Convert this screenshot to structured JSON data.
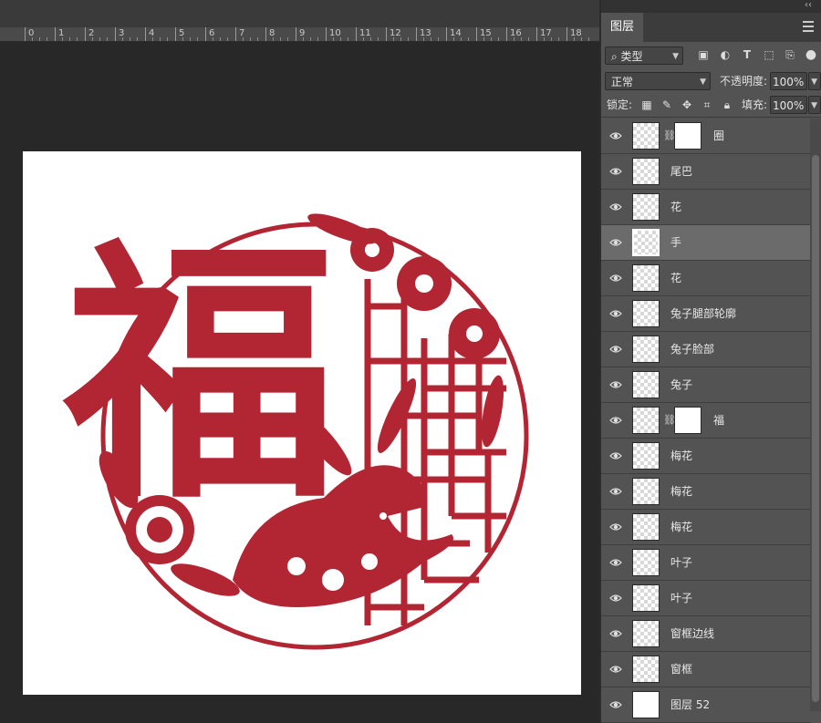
{
  "ruler": {
    "marks": [
      "0",
      "1",
      "2",
      "3",
      "4",
      "5",
      "6",
      "7",
      "8",
      "9",
      "10",
      "11",
      "12",
      "13",
      "14",
      "15",
      "16",
      "17",
      "18"
    ]
  },
  "artwork": {
    "character": "福",
    "color": "#b22634"
  },
  "panel": {
    "tab_label": "图层",
    "filter": {
      "label": "类型"
    },
    "blend_mode": "正常",
    "opacity_label": "不透明度:",
    "opacity_value": "100%",
    "lock_label": "锁定:",
    "fill_label": "填充:",
    "fill_value": "100%"
  },
  "layers": [
    {
      "name": "圈",
      "has_mask": true,
      "selected": false
    },
    {
      "name": "尾巴",
      "has_mask": false,
      "selected": false
    },
    {
      "name": "花",
      "has_mask": false,
      "selected": false
    },
    {
      "name": "手",
      "has_mask": false,
      "selected": true
    },
    {
      "name": "花",
      "has_mask": false,
      "selected": false
    },
    {
      "name": "兔子腿部轮廓",
      "has_mask": false,
      "selected": false
    },
    {
      "name": "兔子脸部",
      "has_mask": false,
      "selected": false
    },
    {
      "name": "兔子",
      "has_mask": false,
      "selected": false
    },
    {
      "name": "福",
      "has_mask": true,
      "selected": false
    },
    {
      "name": "梅花",
      "has_mask": false,
      "selected": false
    },
    {
      "name": "梅花",
      "has_mask": false,
      "selected": false
    },
    {
      "name": "梅花",
      "has_mask": false,
      "selected": false
    },
    {
      "name": "叶子",
      "has_mask": false,
      "selected": false
    },
    {
      "name": "叶子",
      "has_mask": false,
      "selected": false
    },
    {
      "name": "窗框边线",
      "has_mask": false,
      "selected": false
    },
    {
      "name": "窗框",
      "has_mask": false,
      "selected": false
    },
    {
      "name": "图层 52",
      "has_mask": false,
      "selected": false
    }
  ]
}
